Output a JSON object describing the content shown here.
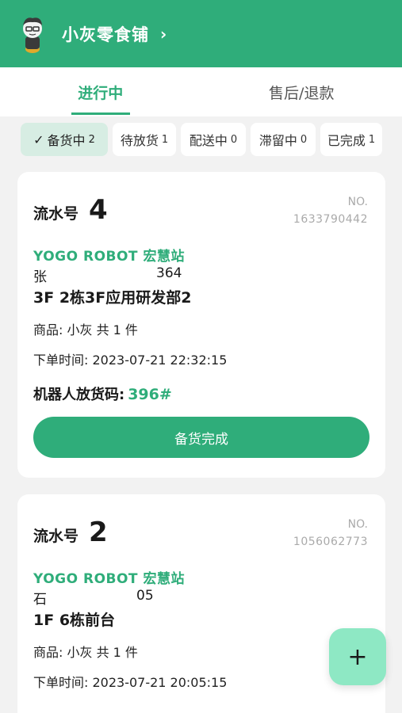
{
  "header": {
    "store_name": "小灰零食铺",
    "chevron": "›",
    "avatar_icon": "robot-avatar-icon",
    "background": "#2fad7a"
  },
  "tabs": [
    {
      "label": "进行中",
      "active": true
    },
    {
      "label": "售后/退款",
      "active": false
    }
  ],
  "filters": [
    {
      "label": "备货中",
      "count": "2",
      "active": true
    },
    {
      "label": "待放货",
      "count": "1",
      "active": false
    },
    {
      "label": "配送中",
      "count": "0",
      "active": false
    },
    {
      "label": "滞留中",
      "count": "0",
      "active": false
    },
    {
      "label": "已完成",
      "count": "1",
      "active": false
    }
  ],
  "orders": [
    {
      "serial_label": "流水号",
      "serial_number": "4",
      "no_label": "NO.",
      "order_no": "1633790442",
      "site": "YOGO ROBOT 宏慧站",
      "customer_name": "张",
      "customer_phone_tail": "364",
      "address": "3F 2栋3F应用研发部2",
      "goods": "商品: 小灰  共 1 件",
      "order_time": "下单时间: 2023-07-21 22:32:15",
      "pickup_code_label": "机器人放货码:",
      "pickup_code": "396#",
      "action_label": "备货完成"
    },
    {
      "serial_label": "流水号",
      "serial_number": "2",
      "no_label": "NO.",
      "order_no": "1056062773",
      "site": "YOGO ROBOT 宏慧站",
      "customer_name": "石",
      "customer_phone_tail": "05",
      "address": "1F 6栋前台",
      "goods": "商品: 小灰  共 1 件",
      "order_time": "下单时间: 2023-07-21 20:05:15"
    }
  ],
  "fab": {
    "label": "+"
  },
  "colors": {
    "accent": "#2fad7a",
    "fab": "#8ee8c4",
    "chip_active": "#d7ede3"
  }
}
